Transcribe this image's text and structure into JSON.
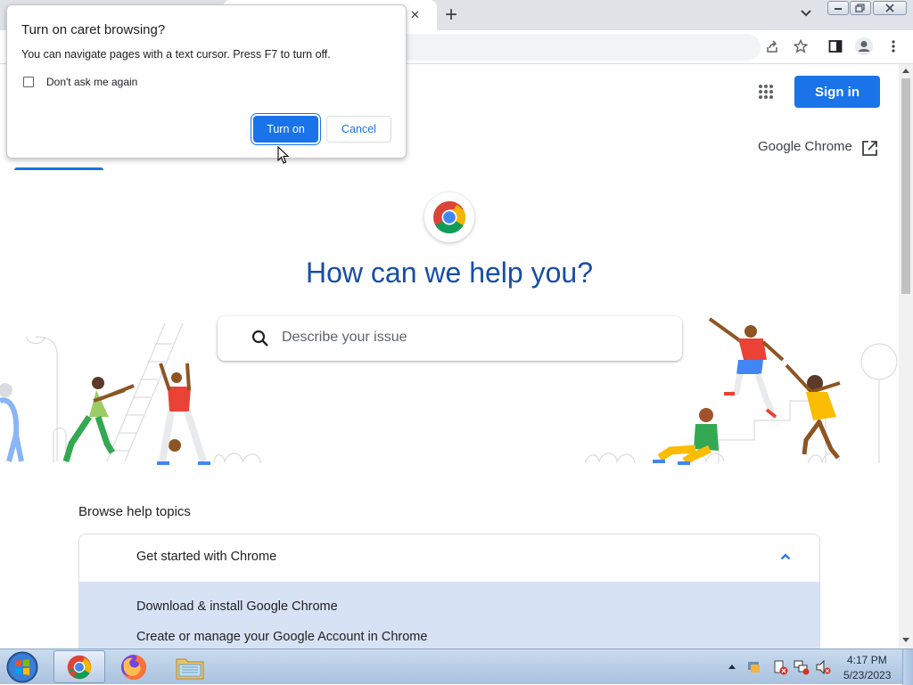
{
  "browser": {
    "new_tab_symbol": "+",
    "close_tab_symbol": "✕"
  },
  "page": {
    "sign_in_label": "Sign in",
    "chrome_link_label": "Google Chrome",
    "hero_title": "How can we help you?",
    "search_placeholder": "Describe your issue",
    "browse_title": "Browse help topics",
    "topic_heading": "Get started with Chrome",
    "topic_items": [
      "Download & install Google Chrome",
      "Create or manage your Google Account in Chrome"
    ]
  },
  "dialog": {
    "title": "Turn on caret browsing?",
    "message": "You can navigate pages with a text cursor. Press F7 to turn off.",
    "checkbox_label": "Don't ask me again",
    "checkbox_checked": false,
    "primary_label": "Turn on",
    "secondary_label": "Cancel"
  },
  "taskbar": {
    "time": "4:17 PM",
    "date": "5/23/2023",
    "pinned": [
      "start-orb-icon",
      "chrome-icon",
      "firefox-icon",
      "file-explorer-icon"
    ]
  },
  "colors": {
    "accent": "#1a73e8",
    "hero_text": "#174ea6",
    "topic_bg": "#d7e3f4"
  }
}
